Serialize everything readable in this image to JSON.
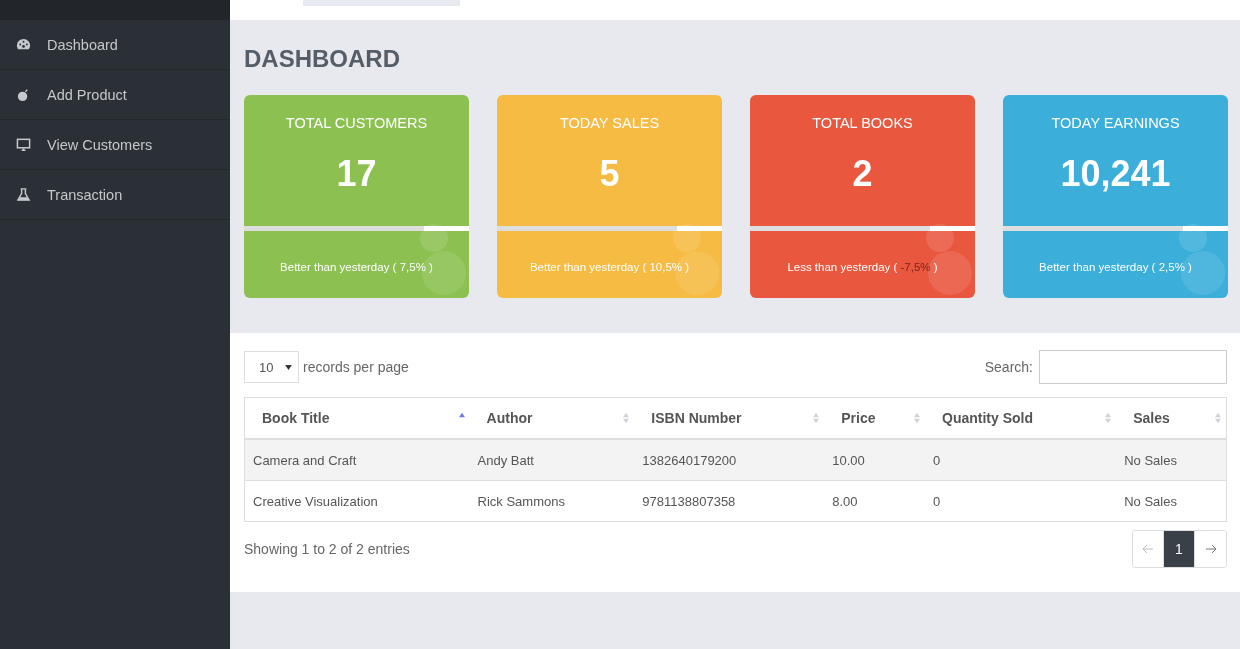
{
  "sidebar": {
    "items": [
      {
        "label": "Dashboard",
        "selected": false
      },
      {
        "label": "Add Product",
        "selected": false
      },
      {
        "label": "View Customers",
        "selected": false
      },
      {
        "label": "Transaction",
        "selected": false
      }
    ]
  },
  "page_title": "DASHBOARD",
  "stats": [
    {
      "title": "TOTAL CUSTOMERS",
      "value": "17",
      "level": 0.8,
      "color": "#8cc152",
      "caption_start": "Better than yesterday (",
      "change": "7,5%",
      "caption_end": ")",
      "negative": false
    },
    {
      "title": "TODAY SALES",
      "value": "5",
      "level": 0.8,
      "color": "#f6bb42",
      "caption_start": "Better than yesterday (",
      "change": "10,5%",
      "caption_end": ")",
      "negative": false
    },
    {
      "title": "TOTAL BOOKS",
      "value": "2",
      "level": 0.8,
      "color": "#e9573f",
      "caption_start": "Less than yesterday (",
      "change": "-7,5%",
      "caption_end": ")",
      "negative": true
    },
    {
      "title": "TODAY EARNINGS",
      "value": "10,241",
      "level": 0.8,
      "color": "#3bafda",
      "caption_start": "Better than yesterday (",
      "change": "2,5%",
      "caption_end": ")",
      "negative": false
    }
  ],
  "table": {
    "page_size": "10",
    "page_size_label": "records per page",
    "search_label": "Search:",
    "columns": [
      {
        "label": "Book Title",
        "sorted": true
      },
      {
        "label": "Author",
        "sorted": false
      },
      {
        "label": "ISBN Number",
        "sorted": false
      },
      {
        "label": "Price",
        "sorted": false
      },
      {
        "label": "Quantity Sold",
        "sorted": false
      },
      {
        "label": "Sales",
        "sorted": false
      }
    ],
    "rows": [
      [
        "Camera and Craft",
        "Andy Batt",
        "1382640179200",
        "10.00",
        "0",
        "No Sales"
      ],
      [
        "Creative Visualization",
        "Rick Sammons",
        "9781138807358",
        "8.00",
        "0",
        "No Sales"
      ]
    ],
    "info": "Showing 1 to 2 of 2 entries",
    "pages": [
      {
        "label": "1",
        "selected": true
      }
    ],
    "prev_disabled": true,
    "next_disabled": false
  }
}
